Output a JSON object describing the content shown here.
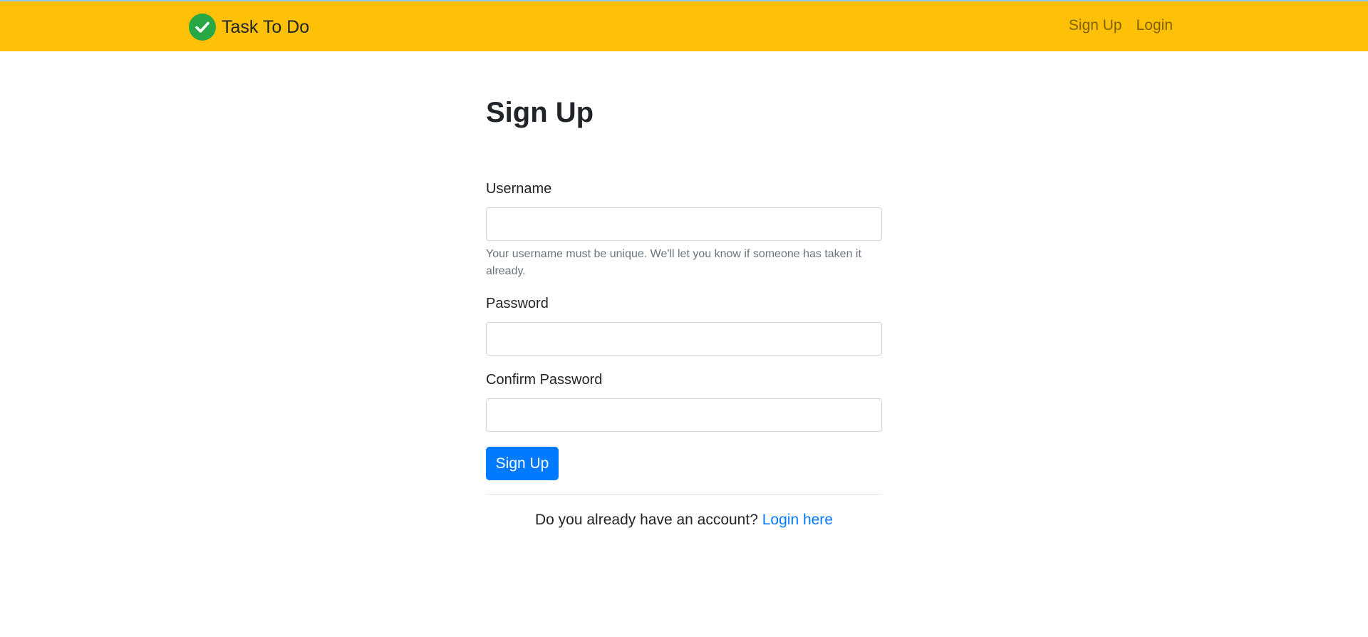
{
  "navbar": {
    "brand_label": "Task To Do",
    "brand_icon": "check-circle-icon",
    "links": [
      {
        "label": "Sign Up"
      },
      {
        "label": "Login"
      }
    ]
  },
  "colors": {
    "navbar_bg": "#ffc107",
    "brand_icon_bg": "#28a745",
    "primary": "#007bff"
  },
  "form": {
    "title": "Sign Up",
    "username": {
      "label": "Username",
      "value": "",
      "help": "Your username must be unique. We'll let you know if someone has taken it already."
    },
    "password": {
      "label": "Password",
      "value": ""
    },
    "confirm_password": {
      "label": "Confirm Password",
      "value": ""
    },
    "submit_label": "Sign Up"
  },
  "footer": {
    "prompt": "Do you already have an account?",
    "link_label": "Login here"
  }
}
